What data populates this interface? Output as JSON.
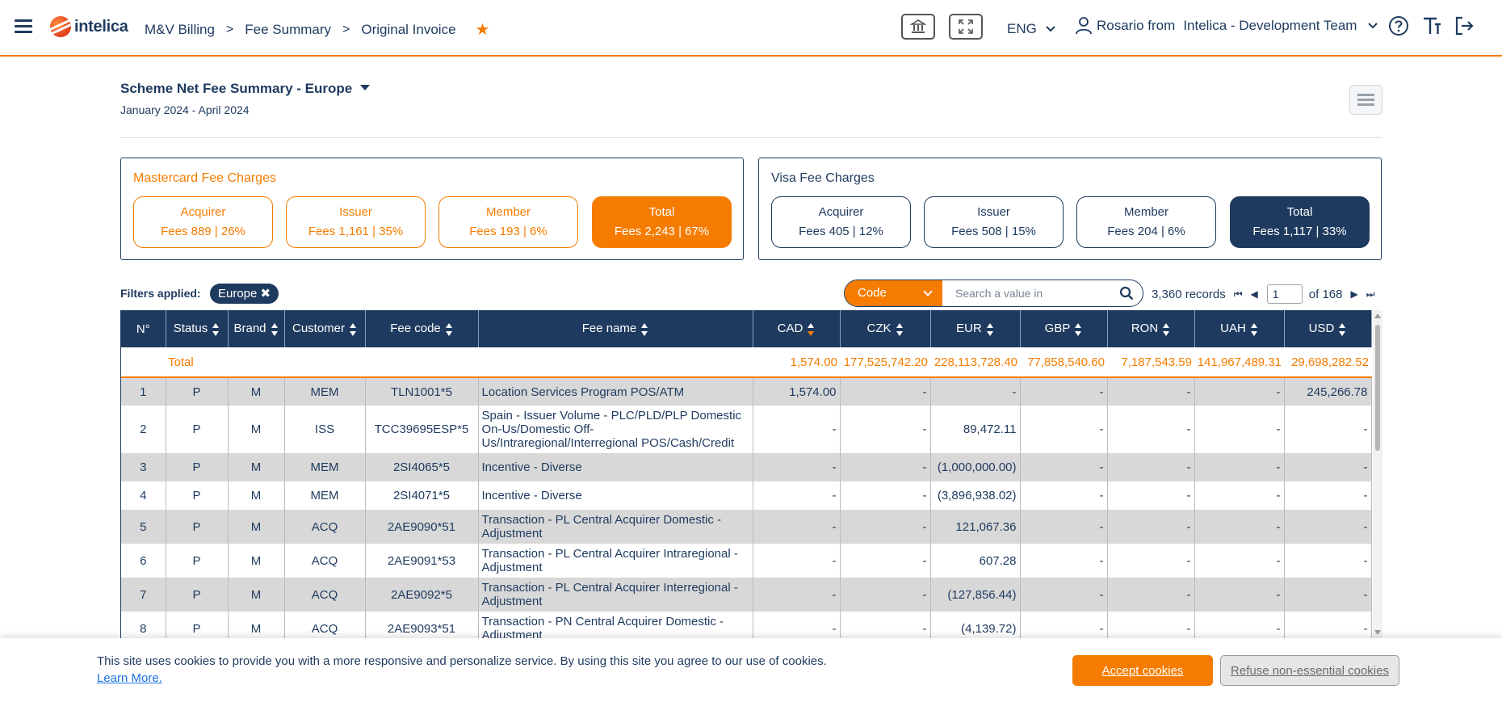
{
  "app": {
    "logo_text": "intelica",
    "breadcrumbs": [
      "M&V Billing",
      "Fee Summary",
      "Original Invoice"
    ],
    "language": "ENG",
    "user_name": "Rosario from",
    "user_org": "Intelica - Development Team",
    "accent_color": "#f57c00",
    "primary_color": "#1e3a5f"
  },
  "header": {
    "title": "Scheme Net Fee Summary - Europe",
    "period": "January 2024 - April 2024"
  },
  "mastercard": {
    "title": "Mastercard Fee Charges",
    "cards": [
      {
        "label": "Acquirer",
        "value": "Fees 889 | 26%"
      },
      {
        "label": "Issuer",
        "value": "Fees 1,161 | 35%"
      },
      {
        "label": "Member",
        "value": "Fees 193 | 6%"
      },
      {
        "label": "Total",
        "value": "Fees 2,243 | 67%"
      }
    ]
  },
  "visa": {
    "title": "Visa Fee Charges",
    "cards": [
      {
        "label": "Acquirer",
        "value": "Fees 405 | 12%"
      },
      {
        "label": "Issuer",
        "value": "Fees 508 | 15%"
      },
      {
        "label": "Member",
        "value": "Fees 204 | 6%"
      },
      {
        "label": "Total",
        "value": "Fees 1,117 | 33%"
      }
    ]
  },
  "filters": {
    "label": "Filters applied:",
    "chips": [
      "Europe"
    ]
  },
  "search": {
    "field": "Code",
    "placeholder": "Search a value in"
  },
  "pager": {
    "records": "3,360 records",
    "page": "1",
    "of": "of 168"
  },
  "table": {
    "columns": [
      "N°",
      "Status",
      "Brand",
      "Customer",
      "Fee code",
      "Fee name",
      "CAD",
      "CZK",
      "EUR",
      "GBP",
      "RON",
      "UAH",
      "USD"
    ],
    "total": {
      "label": "Total",
      "values": [
        "1,574.00",
        "177,525,742.20",
        "228,113,728.40",
        "77,858,540.60",
        "7,187,543.59",
        "141,967,489.31",
        "29,698,282.52"
      ]
    },
    "rows": [
      {
        "n": "1",
        "status": "P",
        "brand": "M",
        "customer": "MEM",
        "code": "TLN1001*5",
        "name": "Location Services Program POS/ATM",
        "values": [
          "1,574.00",
          "-",
          "-",
          "-",
          "-",
          "-",
          "245,266.78"
        ]
      },
      {
        "n": "2",
        "status": "P",
        "brand": "M",
        "customer": "ISS",
        "code": "TCC39695ESP*5",
        "name": "Spain - Issuer Volume - PLC/PLD/PLP Domestic On-Us/Domestic Off-Us/Intraregional/Interregional POS/Cash/Credit",
        "values": [
          "-",
          "-",
          "89,472.11",
          "-",
          "-",
          "-",
          "-"
        ]
      },
      {
        "n": "3",
        "status": "P",
        "brand": "M",
        "customer": "MEM",
        "code": "2SI4065*5",
        "name": "Incentive - Diverse",
        "values": [
          "-",
          "-",
          "(1,000,000.00)",
          "-",
          "-",
          "-",
          "-"
        ]
      },
      {
        "n": "4",
        "status": "P",
        "brand": "M",
        "customer": "MEM",
        "code": "2SI4071*5",
        "name": "Incentive - Diverse",
        "values": [
          "-",
          "-",
          "(3,896,938.02)",
          "-",
          "-",
          "-",
          "-"
        ]
      },
      {
        "n": "5",
        "status": "P",
        "brand": "M",
        "customer": "ACQ",
        "code": "2AE9090*51",
        "name": "Transaction - PL Central Acquirer Domestic - Adjustment",
        "values": [
          "-",
          "-",
          "121,067.36",
          "-",
          "-",
          "-",
          "-"
        ]
      },
      {
        "n": "6",
        "status": "P",
        "brand": "M",
        "customer": "ACQ",
        "code": "2AE9091*53",
        "name": "Transaction - PL Central Acquirer Intraregional - Adjustment",
        "values": [
          "-",
          "-",
          "607.28",
          "-",
          "-",
          "-",
          "-"
        ]
      },
      {
        "n": "7",
        "status": "P",
        "brand": "M",
        "customer": "ACQ",
        "code": "2AE9092*5",
        "name": "Transaction - PL Central Acquirer Interregional - Adjustment",
        "values": [
          "-",
          "-",
          "(127,856.44)",
          "-",
          "-",
          "-",
          "-"
        ]
      },
      {
        "n": "8",
        "status": "P",
        "brand": "M",
        "customer": "ACQ",
        "code": "2AE9093*51",
        "name": "Transaction - PN Central Acquirer Domestic - Adjustment",
        "values": [
          "-",
          "-",
          "(4,139.72)",
          "-",
          "-",
          "-",
          "-"
        ]
      }
    ]
  },
  "cookie": {
    "text": "This site uses cookies to provide you with a more responsive and personalize service. By using this site you agree to our use of cookies.",
    "link": "Learn More.",
    "accept": "Accept cookies",
    "refuse": "Refuse non-essential cookies"
  }
}
